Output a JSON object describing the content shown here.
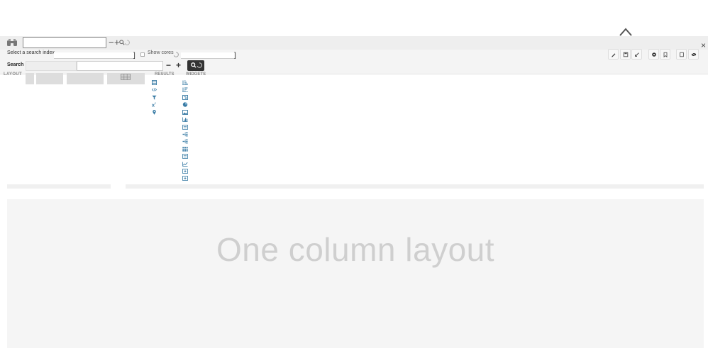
{
  "top_search": {
    "value": "",
    "minus": "−",
    "plus": "+"
  },
  "close": "×",
  "index": {
    "label": "Select a search index",
    "value": "",
    "bracket_close": "]"
  },
  "cores": {
    "label": "Show cores",
    "value": "",
    "bracket_close": "]"
  },
  "query": {
    "label": "Search",
    "value": "",
    "minus": "−",
    "plus": "+"
  },
  "toolbar_icons": [
    "pencil-icon",
    "save-icon",
    "expand-icon",
    "gear-icon",
    "bookmark-icon",
    "new-document-icon",
    "eye-slash-icon"
  ],
  "sidebar": {
    "layout_label": "LAYOUT",
    "results_label": "RESULTS",
    "widgets_label": "WIDGETS",
    "results_icons": [
      "table-icon",
      "code-icon",
      "filter-icon",
      "superscript-icon",
      "map-marker-icon"
    ],
    "widget_icons": [
      "sort-amount-asc-icon",
      "sort-amount-desc-icon",
      "level-icon",
      "pie-chart-icon",
      "image-icon",
      "bar-chart-icon",
      "text-icon",
      "tree-icon",
      "tree-alt-icon",
      "grid-icon",
      "text-alt-icon",
      "line-chart-icon",
      "download-icon",
      "download-alt-icon"
    ]
  },
  "main": {
    "layout_title": "One column layout"
  },
  "colors": {
    "accent": "#3a7ca5",
    "search_button": "#333333",
    "panel_bg": "#f5f5f5"
  }
}
